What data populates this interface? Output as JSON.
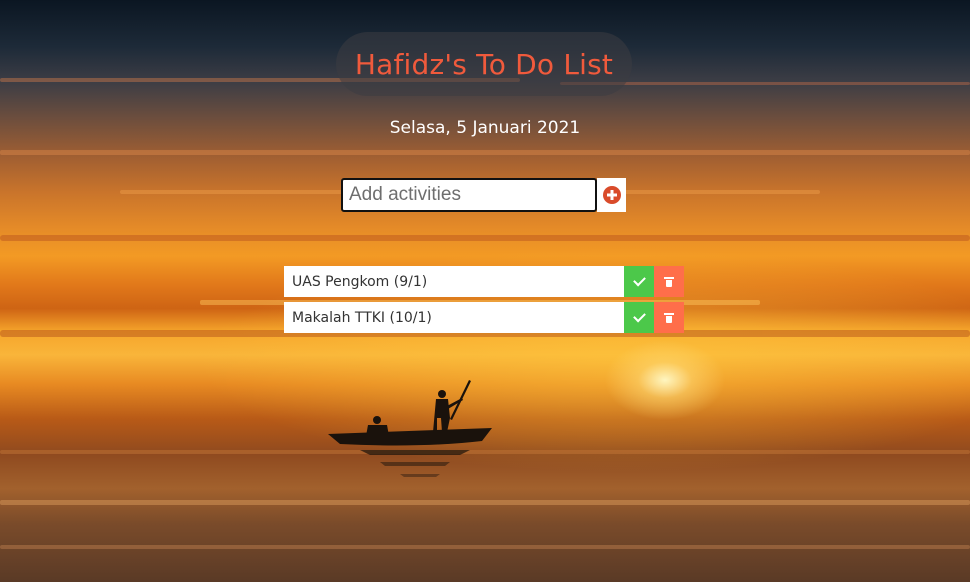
{
  "header": {
    "title": "Hafidz's To Do List",
    "date": "Selasa, 5 Januari 2021"
  },
  "add_form": {
    "placeholder": "Add activities",
    "value": "",
    "add_icon": "plus-circle-icon"
  },
  "todos": [
    {
      "text": "UAS Pengkom (9/1)",
      "complete_icon": "check-icon",
      "delete_icon": "trash-icon"
    },
    {
      "text": "Makalah TTKI (10/1)",
      "complete_icon": "check-icon",
      "delete_icon": "trash-icon"
    }
  ],
  "colors": {
    "title": "#f05a3c",
    "complete_button": "#4cc84a",
    "delete_button": "#ff6e4a",
    "add_icon": "#d94b2b"
  }
}
